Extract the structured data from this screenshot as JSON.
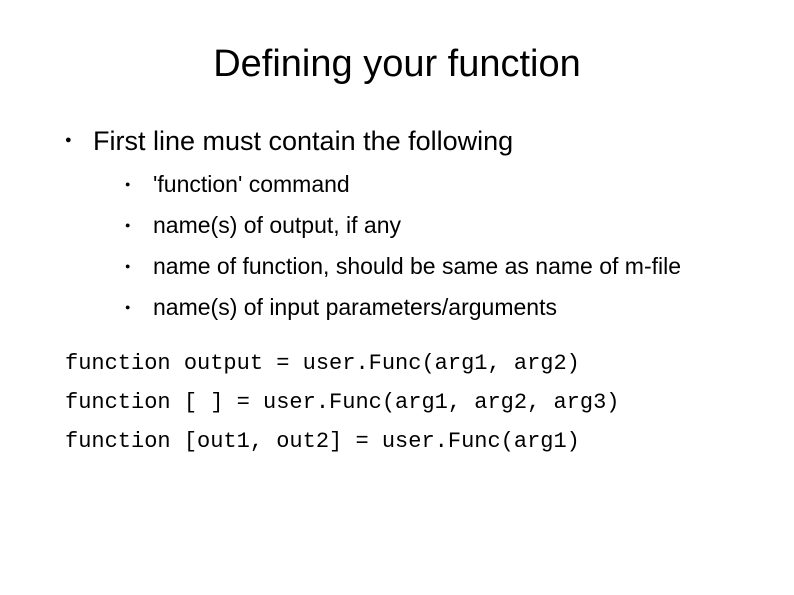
{
  "title": "Defining your function",
  "main_item": "First line must contain the following",
  "sub_items": [
    "'function' command",
    "name(s) of output, if any",
    "name of function, should be same as name of m-file",
    "name(s) of input parameters/arguments"
  ],
  "code_lines": [
    "function output = user.Func(arg1, arg2)",
    "function [ ] = user.Func(arg1, arg2, arg3)",
    "function [out1, out2] = user.Func(arg1)"
  ]
}
